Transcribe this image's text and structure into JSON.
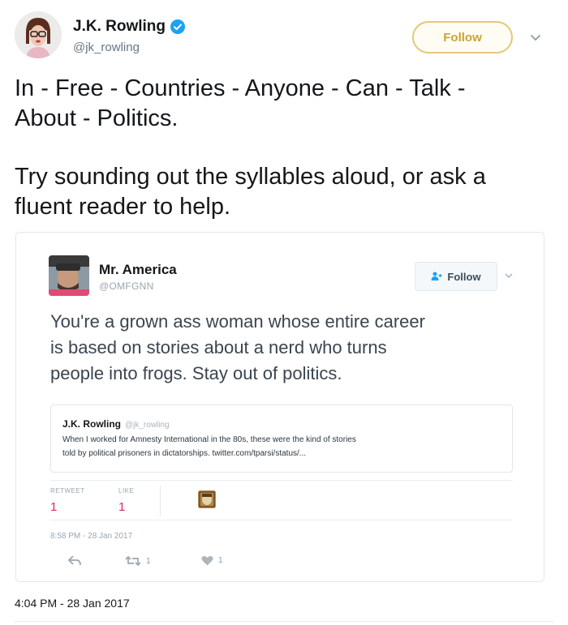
{
  "tweet": {
    "author_name": "J.K. Rowling",
    "author_handle": "@jk_rowling",
    "follow_label": "Follow",
    "paragraph1_line1": "In - Free - Countries - Anyone - Can - Talk -",
    "paragraph1_line2": "About - Politics.",
    "paragraph2_line1": "Try sounding out the syllables aloud, or ask a",
    "paragraph2_line2": "fluent reader to help.",
    "timestamp": "4:04 PM - 28 Jan 2017",
    "accent_color": "#e3c77a"
  },
  "embedded_tweet": {
    "author_name": "Mr. America",
    "author_handle": "@OMFGNN",
    "follow_label": "Follow",
    "text_line1": "You're a grown ass woman whose entire career",
    "text_line2": "is based on stories about a nerd who turns",
    "text_line3": "people into frogs. Stay out of politics.",
    "quoted": {
      "author_name": "J.K. Rowling",
      "author_handle": "@jk_rowling",
      "line1": "When I worked for Amnesty International in the 80s, these were the kind of stories",
      "line2": "told by political prisoners in dictatorships. twitter.com/tparsi/status/..."
    },
    "stats": {
      "retweet_label": "RETWEET",
      "retweet_count": "1",
      "like_label": "LIKE",
      "like_count": "1"
    },
    "timestamp": "8:58 PM - 28 Jan 2017",
    "actions": {
      "retweet_count": "1",
      "like_count": "1"
    },
    "icons": [
      "reply-icon",
      "retweet-icon",
      "heart-icon",
      "add-user-icon",
      "chevron-down-icon"
    ],
    "stat_color": "#e0245e"
  }
}
